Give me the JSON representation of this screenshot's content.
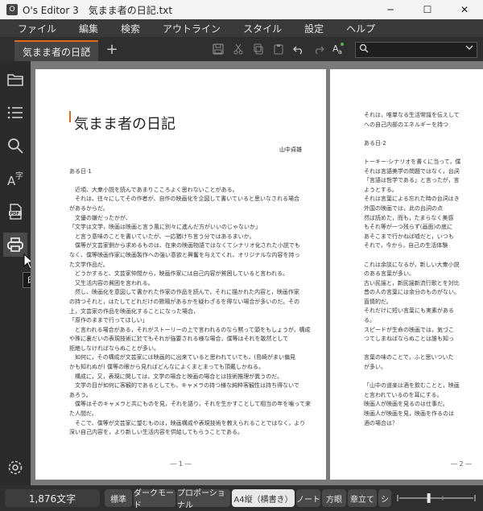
{
  "window": {
    "title": "O's Editor 3　気まま者の日記.txt",
    "minimize": "─",
    "maximize": "☐",
    "close": "✕"
  },
  "menu": [
    "ファイル",
    "編集",
    "検索",
    "アウトライン",
    "スタイル",
    "設定",
    "ヘルプ"
  ],
  "tab": {
    "label": "気まま者の日記",
    "close": "×"
  },
  "newtab": "+",
  "search": {
    "placeholder": ""
  },
  "tooltip": "印刷",
  "page1": {
    "title": "気まま者の日記",
    "author": "山中貞雄",
    "lines": [
      "",
      "ある日·1",
      "",
      "　近頃、大衆小説を読んであまりこころよく思わないことがある。",
      "　それは、往々にしてその作者が、自作の映画化を企図して書いていると思いなされる場合",
      "があるからだ。",
      "　文優の嫌だったかが、",
      "「文学は文学，映画は映画と言う風に別々に進んだ方がいいのじゃないか」",
      "　と言う意味のことを書いていたが、一応猶けち言う分ではあるまいか。",
      "　僕等が文芸家側から求めるものは、在来の映画物語ではなくてシナリオ化された小説でも",
      "なく、僕等映画作家に映画製作への強い意欲と興奮を与えてくれ、オリジナルな内容を持っ",
      "た文学作品だ。",
      "　どうかすると、文芸家仲間から，映画作家には自己内容が貧困していると言われる。",
      "　又生活内容の貧困を言われる。",
      "　然し、映画化を意図して書かれた作家の作品を読んで，それに描かれた内容と，映画作家",
      "の持つそれと，はたしてどれだけの懸隔があるかを疑わざるを得ない場合が多いのだ。その",
      "上，文芸家の作品を映画化することになった場合，",
      "「原作のままで行ってほしい」",
      "　と言われる場合がある，それがストーリーの上で言われるのなら黙って頭をもしょうが，構成",
      "や殊に裏だいの表現技術に於てもそれが強要される様な場合，僕等はそれを敢然として",
      "拒絶しなければならぬことが多い。",
      "　如何に，その構成が文芸家には映画的に出来ていると思われていても，(島崎がまい偏見",
      "かも知れぬが) 僕等の眼から見ればどんなによくまとまっても頂戴しかねる。",
      "　構成に，又，表現に関しては，文学の場合と映画の場合とは技術推理が異うのだ。",
      "　文学の目が如何に客観的であるとしても，キャメラの持つ様な純粋客観性は持ち得ないで",
      "あろう。",
      "　僕等はそのキャメラと共にものを見，それを語り，それを生かすことして相当の年を噛って来",
      "た人間だ。",
      "　そこで、僕等が文芸家に望むものは，映画構成や表現技術を教えられることではなく，より",
      "深い自己内容を，より新しい生活内容を供給してもらうことである。"
    ],
    "page_number": "― 1 ―"
  },
  "page2": {
    "lines": [
      "それは，唯単なる生活常識を伝えして",
      "への自己内部のエネルギーを持つ",
      "",
      "ある日·2",
      "",
      "トーキー·シナリオを書くに当って，僕",
      "それは言語美学の問題ではなく，台詞",
      "「言語は哲学である」と言ったが，言",
      "ようとする。",
      "それは言葉による忘れた時の台詞はき",
      "外国の映画では，此の台詞の点",
      "然ば読めた，而も，たまらなく美感",
      "もそれ等が一つ残らず(画面)の底に",
      "あそこまで行かねば嘘だと，いつも",
      "それで，今から，自己の生活体験",
      "",
      "これは余談になるが，新しい大衆小説",
      "のある言葉が多い。",
      "古い民謡と，新民謡新流行歌とを対比",
      "昔の人の言葉には余分のものがない。",
      "直情的だ。",
      "それだけに短い言葉にも実素がある",
      "る。",
      "スピードが生命の映画では，気づこ",
      "つてしまねばならぬことは誰も知っ",
      "",
      "言葉の味のことで，ふと思いついた",
      "が多い。",
      "",
      "「山中の道楽は酒を飲むことと，映画",
      "と言われているのを耳にする。",
      "映画人が映画を見るのは仕事だ。",
      "映画人が映画を見，映画を作るのは",
      "酒の場合は？"
    ],
    "page_number": "― 2 ―"
  },
  "status": {
    "char_count": "1,876文字",
    "buttons": [
      "標準",
      "ダークモード",
      "プロポーショナル",
      "A4縦（横書き）",
      "ノート",
      "方眼",
      "章立て",
      "シ"
    ],
    "selected_index": 3,
    "zoom_level": 0.42
  },
  "colors": {
    "accent": "#e06a1e",
    "background": "#2b2b2b",
    "page": "#ffffff"
  },
  "sidebar_icons": [
    "folder-icon",
    "outline-list-icon",
    "search-icon",
    "font-style-icon",
    "pdf-icon",
    "printer-icon",
    "settings-icon"
  ]
}
